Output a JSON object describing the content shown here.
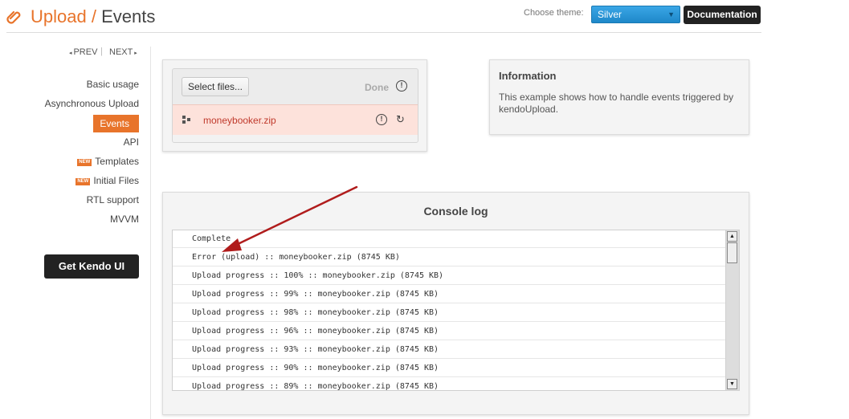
{
  "header": {
    "section": "Upload",
    "separator": "/",
    "page": "Events",
    "theme_label": "Choose theme:",
    "theme_value": "Silver",
    "doc_button": "Documentation"
  },
  "pager": {
    "prev": "PREV",
    "divider": "|",
    "next": "NEXT"
  },
  "sidebar": {
    "items": [
      {
        "label": "Basic usage"
      },
      {
        "label": "Asynchronous Upload"
      },
      {
        "label": "Events",
        "active": true
      },
      {
        "label": "API"
      },
      {
        "label": "Templates",
        "badge": "NEW"
      },
      {
        "label": "Initial Files",
        "badge": "NEW"
      },
      {
        "label": "RTL support"
      },
      {
        "label": "MVVM"
      }
    ],
    "cta": "Get Kendo UI"
  },
  "upload": {
    "select_button": "Select files...",
    "done_label": "Done",
    "file_name": "moneybooker.zip",
    "warn_glyph": "!",
    "retry_glyph": "↻"
  },
  "info": {
    "title": "Information",
    "text": "This example shows how to handle events triggered by kendoUpload."
  },
  "console": {
    "title": "Console log",
    "rows": [
      "Complete",
      "Error (upload) :: moneybooker.zip (8745 KB)",
      "Upload progress :: 100% :: moneybooker.zip (8745 KB)",
      "Upload progress :: 99% :: moneybooker.zip (8745 KB)",
      "Upload progress :: 98% :: moneybooker.zip (8745 KB)",
      "Upload progress :: 96% :: moneybooker.zip (8745 KB)",
      "Upload progress :: 93% :: moneybooker.zip (8745 KB)",
      "Upload progress :: 90% :: moneybooker.zip (8745 KB)",
      "Upload progress :: 89% :: moneybooker.zip (8745 KB)"
    ]
  },
  "colors": {
    "accent": "#e8742b",
    "error_bg": "#fde2db",
    "error_text": "#c0392b",
    "annotation": "#b01c1c"
  }
}
